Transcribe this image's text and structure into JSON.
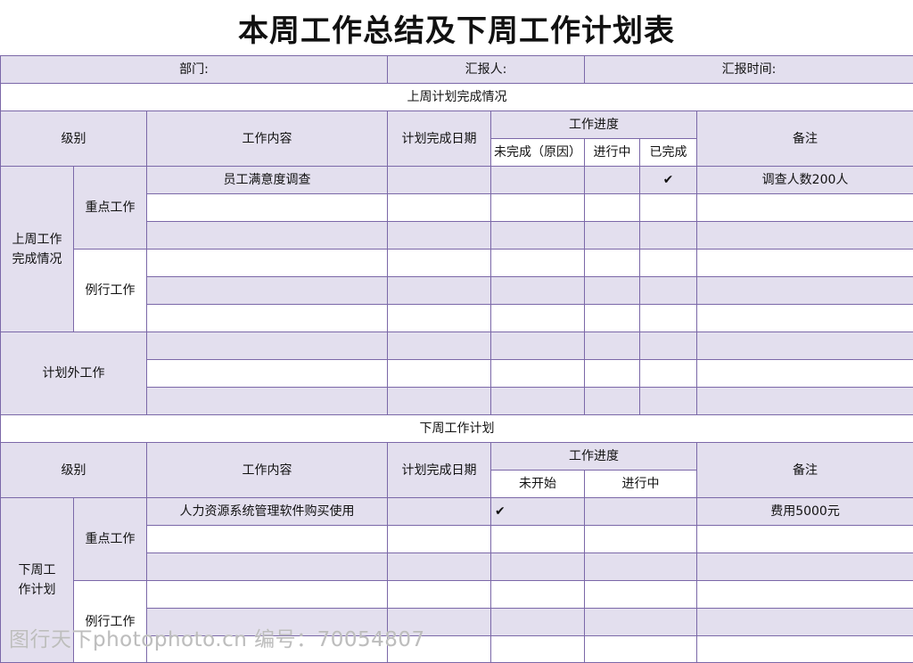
{
  "title": "本周工作总结及下周工作计划表",
  "info": {
    "department": "部门:",
    "reporter": "汇报人:",
    "report_time": "汇报时间:"
  },
  "section1": {
    "title": "上周计划完成情况",
    "h_level": "级别",
    "h_content": "工作内容",
    "h_date": "计划完成日期",
    "h_progress": "工作进度",
    "h_incomplete": "未完成（原因）",
    "h_inprogress": "进行中",
    "h_done": "已完成",
    "h_notes": "备注",
    "group": "上周工作完成情况",
    "key_work": "重点工作",
    "routine_work": "例行工作",
    "unplanned": "计划外工作",
    "row1": {
      "content": "员工满意度调查",
      "done_mark": "✔",
      "note": "调查人数200人"
    }
  },
  "section2": {
    "title": "下周工作计划",
    "h_level": "级别",
    "h_content": "工作内容",
    "h_date": "计划完成日期",
    "h_progress": "工作进度",
    "h_notstarted": "未开始",
    "h_inprogress": "进行中",
    "h_notes": "备注",
    "group": "下周工作计划",
    "key_work": "重点工作",
    "routine_work": "例行工作",
    "row1": {
      "content": "人力资源系统管理软件购买使用",
      "notstarted_mark": "✔",
      "note": "费用5000元"
    }
  },
  "watermark": "图行天下photophoto.cn 编号：70054807"
}
